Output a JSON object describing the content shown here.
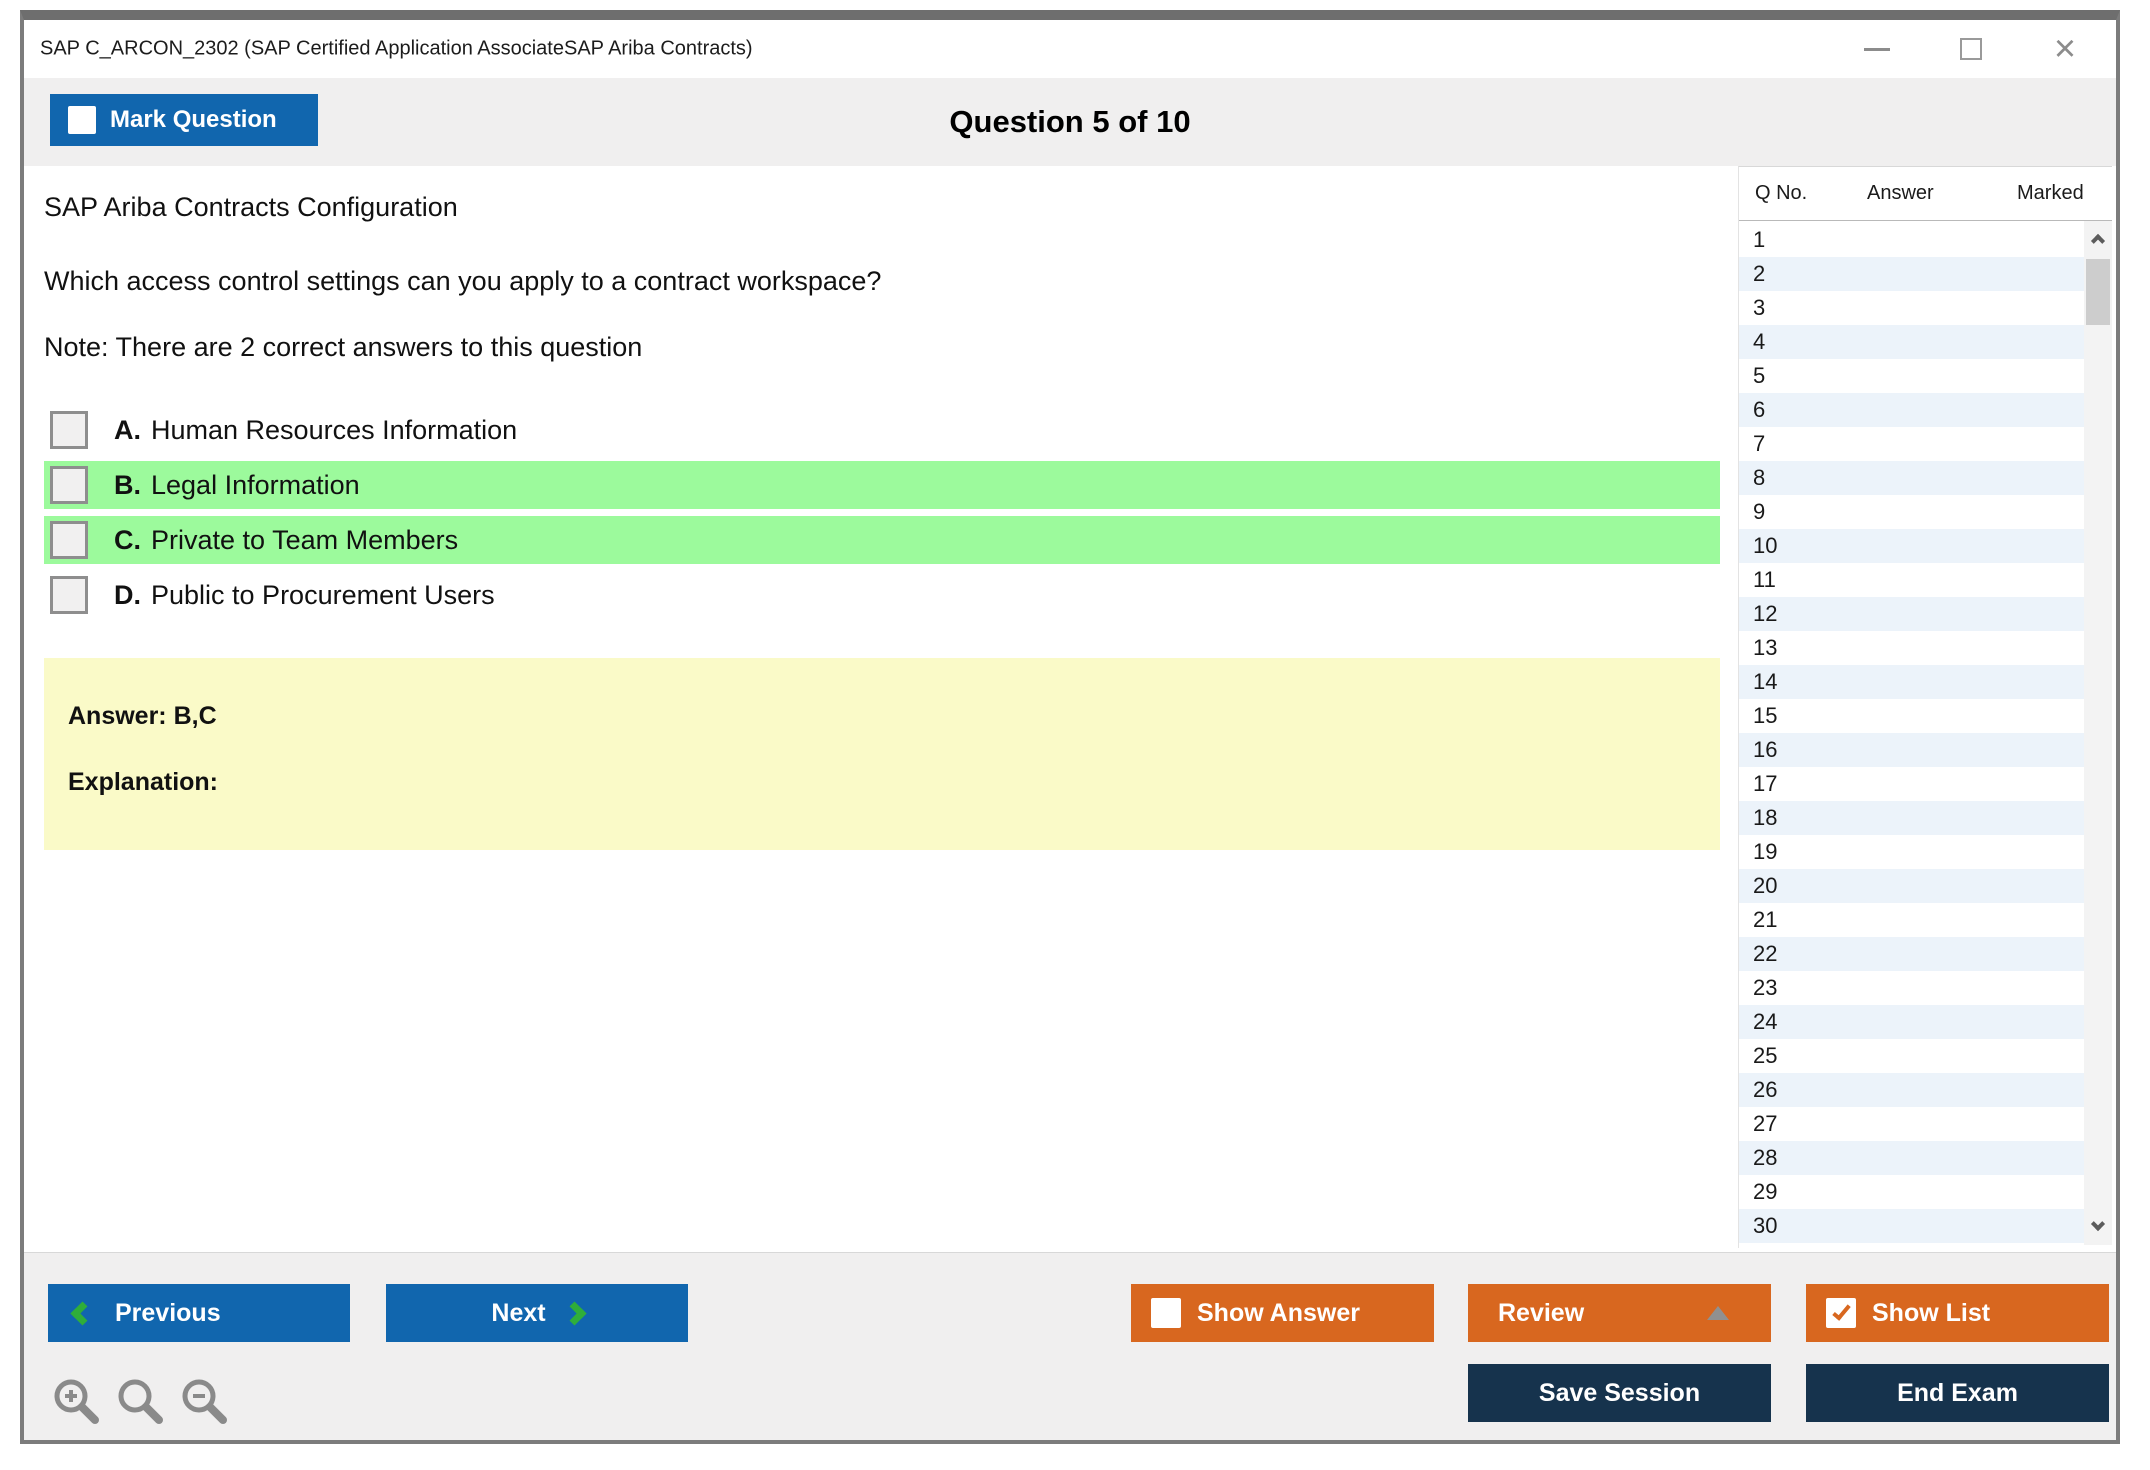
{
  "window": {
    "title": "SAP C_ARCON_2302 (SAP Certified Application AssociateSAP Ariba Contracts)"
  },
  "header": {
    "mark_question_label": "Mark Question",
    "question_counter": "Question 5 of 10"
  },
  "question": {
    "topic": "SAP Ariba Contracts Configuration",
    "prompt": "Which access control settings can you apply to a contract workspace?",
    "note": "Note: There are 2 correct answers to this question",
    "options": [
      {
        "letter": "A.",
        "label": "Human Resources Information",
        "highlighted": false,
        "checked": false
      },
      {
        "letter": "B.",
        "label": "Legal Information",
        "highlighted": true,
        "checked": false
      },
      {
        "letter": "C.",
        "label": "Private to Team Members",
        "highlighted": true,
        "checked": false
      },
      {
        "letter": "D.",
        "label": "Public to Procurement Users",
        "highlighted": false,
        "checked": false
      }
    ],
    "answer": "Answer: B,C",
    "explanation": "Explanation:"
  },
  "question_list": {
    "columns": [
      "Q No.",
      "Answer",
      "Marked"
    ],
    "rows": [
      "1",
      "2",
      "3",
      "4",
      "5",
      "6",
      "7",
      "8",
      "9",
      "10",
      "11",
      "12",
      "13",
      "14",
      "15",
      "16",
      "17",
      "18",
      "19",
      "20",
      "21",
      "22",
      "23",
      "24",
      "25",
      "26",
      "27",
      "28",
      "29",
      "30"
    ]
  },
  "footer": {
    "previous": "Previous",
    "next": "Next",
    "show_answer": "Show Answer",
    "review": "Review",
    "show_list": "Show List",
    "save_session": "Save Session",
    "end_exam": "End Exam"
  },
  "states": {
    "mark_question_checked": false,
    "show_answer_checked": false,
    "show_list_checked": true
  },
  "colors": {
    "accent_blue": "#1166ae",
    "accent_orange": "#d8671f",
    "dark_navy": "#16334d",
    "highlight_green": "#9cfa9c",
    "answer_yellow": "#fafac8",
    "row_alt_blue": "#ecf3fa",
    "chevron_green": "#2fae3a"
  }
}
